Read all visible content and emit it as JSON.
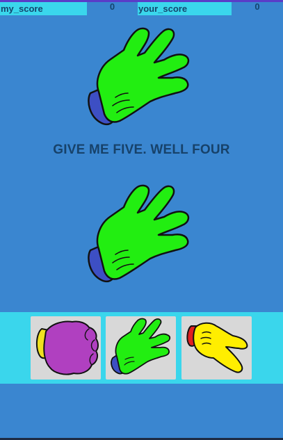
{
  "scoreboard": {
    "my_label": "my_score",
    "my_value": "0",
    "your_label": "your_score",
    "your_value": "0"
  },
  "message": "GIVE ME FIVE. WELL FOUR",
  "colors": {
    "background": "#3a86d0",
    "bar": "#3ad6ec",
    "spock_hand": "#22ee11",
    "rock_hand": "#b040c0",
    "scissors_hand": "#ffee00"
  },
  "icons": {
    "top": "spock-hand-icon",
    "bottom": "spock-hand-icon",
    "choices": [
      "rock-hand-icon",
      "spock-hand-icon",
      "scissors-hand-icon"
    ]
  }
}
